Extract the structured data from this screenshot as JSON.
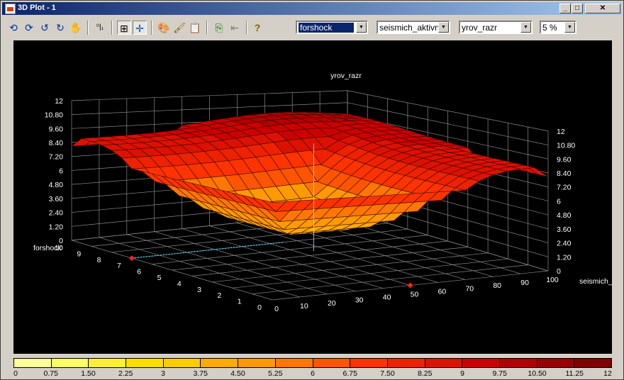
{
  "window": {
    "title": "3D Plot - 1"
  },
  "toolbar": {
    "combos": [
      {
        "name": "x-axis-combo",
        "value": "forshock"
      },
      {
        "name": "y-axis-combo",
        "value": "seismich_aktivn"
      },
      {
        "name": "z-axis-combo",
        "value": "yrov_razr"
      },
      {
        "name": "step-combo",
        "value": "5 %"
      }
    ]
  },
  "axes": {
    "z_title": "yrov_razr",
    "left_title": "forshock",
    "right_title": "seismich_a",
    "z_ticks": [
      "12",
      "10.80",
      "9.60",
      "8.40",
      "7.20",
      "6",
      "4.80",
      "3.60",
      "2.40",
      "1.20",
      "0"
    ],
    "right_z_ticks": [
      "12",
      "10.80",
      "9.60",
      "8.40",
      "7.20",
      "6",
      "4.80",
      "3.60",
      "2.40",
      "1.20",
      "0"
    ],
    "forshock_ticks": [
      "0",
      "1",
      "2",
      "3",
      "4",
      "5",
      "6",
      "7",
      "8",
      "9",
      "10"
    ],
    "seismich_ticks": [
      "0",
      "10",
      "20",
      "30",
      "40",
      "50",
      "60",
      "70",
      "80",
      "90",
      "100"
    ]
  },
  "colorbar": {
    "ticks": [
      "0",
      "0.75",
      "1.50",
      "2.25",
      "3",
      "3.75",
      "4.50",
      "5.25",
      "6",
      "6.75",
      "7.50",
      "8.25",
      "9",
      "9.75",
      "10.50",
      "11.25",
      "12"
    ],
    "colors": [
      "#ffff99",
      "#ffff66",
      "#ffee33",
      "#ffdd00",
      "#ffcc00",
      "#ffaa00",
      "#ff9900",
      "#ff7700",
      "#ff5500",
      "#ff3300",
      "#ee2200",
      "#dd1100",
      "#cc0000",
      "#b30000",
      "#990000",
      "#800000"
    ]
  },
  "chart_data": {
    "type": "surface",
    "x_label": "seismich_a",
    "y_label": "forshock",
    "z_label": "yrov_razr",
    "x_range": [
      0,
      100
    ],
    "y_range": [
      0,
      10
    ],
    "z_range": [
      0,
      12
    ],
    "surface_shape": "plateau",
    "z_low_center": 3,
    "z_high_plateau": 9,
    "z_edge_rim": 6
  }
}
